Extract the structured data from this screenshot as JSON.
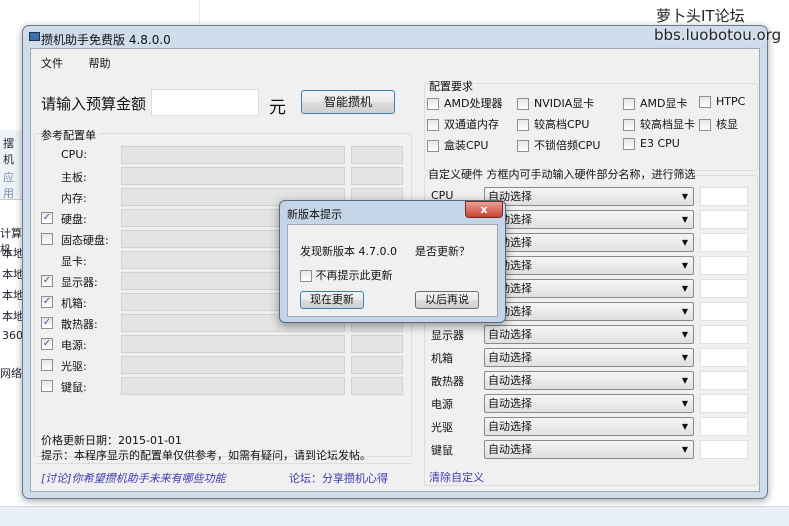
{
  "watermark": {
    "line1": "萝卜头IT论坛",
    "line2": "bbs.luobotou.org"
  },
  "background": {
    "items": [
      "摆机",
      "应用",
      "计算机",
      "本地",
      "本地",
      "本地",
      "本地",
      "360",
      "网络"
    ]
  },
  "window": {
    "title": "攒机助手免费版 4.8.0.0",
    "menu": [
      "文件",
      "帮助"
    ],
    "budget_label": "请输入预算金额",
    "budget_value": "",
    "currency": "元",
    "smart_button": "智能攒机",
    "ref_group": "参考配置单",
    "ref_rows": [
      {
        "label": "CPU:",
        "checkbox": null
      },
      {
        "label": "主板:",
        "checkbox": null
      },
      {
        "label": "内存:",
        "checkbox": null
      },
      {
        "label": "硬盘:",
        "checkbox": true
      },
      {
        "label": "固态硬盘:",
        "checkbox": false
      },
      {
        "label": "显卡:",
        "checkbox": null
      },
      {
        "label": "显示器:",
        "checkbox": true
      },
      {
        "label": "机箱:",
        "checkbox": true
      },
      {
        "label": "散热器:",
        "checkbox": true
      },
      {
        "label": "电源:",
        "checkbox": true
      },
      {
        "label": "光驱:",
        "checkbox": false
      },
      {
        "label": "键鼠:",
        "checkbox": false
      }
    ],
    "price_date": "价格更新日期：2015-01-01",
    "hint": "提示：本程序显示的配置单仅供参考，如需有疑问，请到论坛发帖。",
    "discuss_link": "[讨论]你希望攒机助手未来有哪些功能",
    "forum_link": "论坛：分享攒机心得",
    "req_group": "配置要求",
    "requirements": [
      {
        "label": "AMD处理器",
        "checked": false
      },
      {
        "label": "NVIDIA显卡",
        "checked": false
      },
      {
        "label": "AMD显卡",
        "checked": false
      },
      {
        "label": "HTPC",
        "checked": false
      },
      {
        "label": "双通道内存",
        "checked": false
      },
      {
        "label": "较高档CPU",
        "checked": false
      },
      {
        "label": "较高档显卡",
        "checked": false
      },
      {
        "label": "核显",
        "checked": false
      },
      {
        "label": "盒装CPU",
        "checked": false
      },
      {
        "label": "不锁倍频CPU",
        "checked": false
      },
      {
        "label": "E3 CPU",
        "checked": false
      }
    ],
    "custom_title": "自定义硬件 方框内可手动输入硬件部分名称，进行筛选",
    "custom_rows": [
      {
        "label": "CPU",
        "value": "自动选择"
      },
      {
        "label": "",
        "value": "自动选择"
      },
      {
        "label": "",
        "value": "自动选择"
      },
      {
        "label": "",
        "value": "自动选择"
      },
      {
        "label": "",
        "value": "自动选择"
      },
      {
        "label": "",
        "value": "自动选择"
      },
      {
        "label": "显示器",
        "value": "自动选择"
      },
      {
        "label": "机箱",
        "value": "自动选择"
      },
      {
        "label": "散热器",
        "value": "自动选择"
      },
      {
        "label": "电源",
        "value": "自动选择"
      },
      {
        "label": "光驱",
        "value": "自动选择"
      },
      {
        "label": "键鼠",
        "value": "自动选择"
      }
    ],
    "clear_link": "清除自定义"
  },
  "dialog": {
    "title": "新版本提示",
    "close": "x",
    "message": "发现新版本 4.7.0.0",
    "question": "是否更新？",
    "no_remind": "不再提示此更新",
    "no_remind_checked": false,
    "update_now": "现在更新",
    "later": "以后再说"
  }
}
